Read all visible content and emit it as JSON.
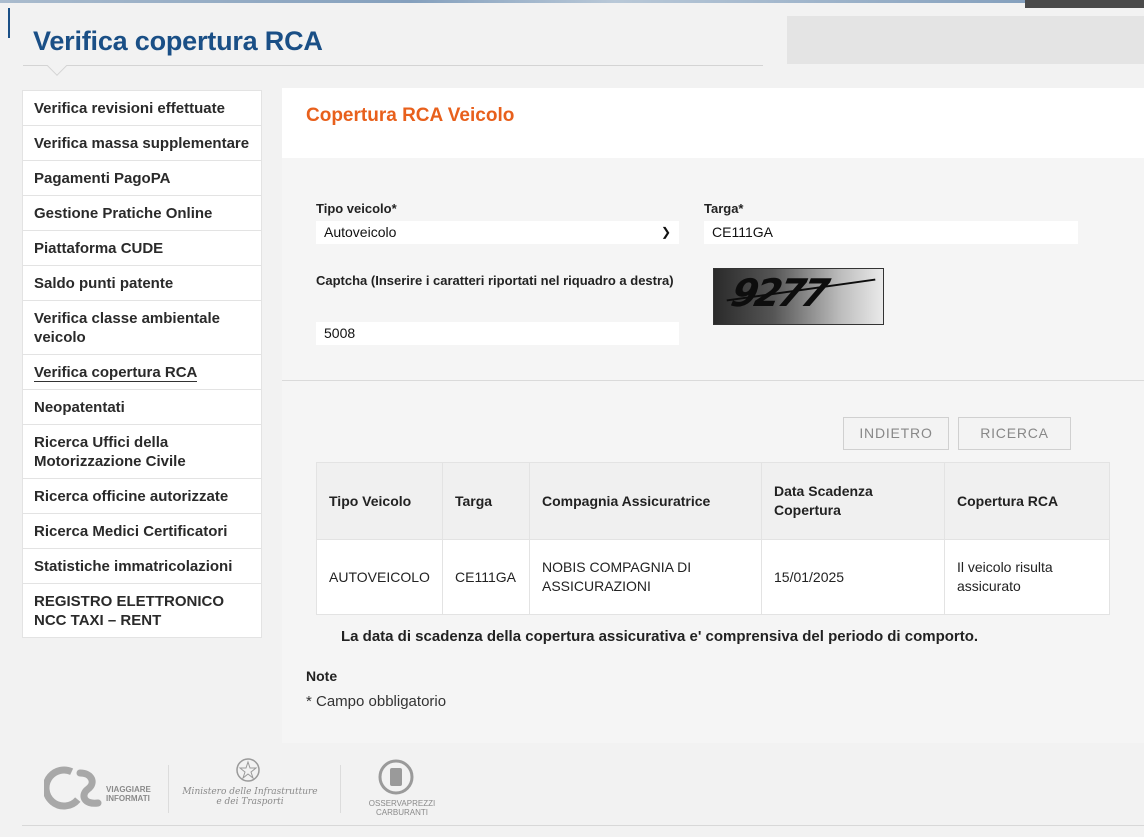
{
  "header": {
    "title": "Verifica copertura RCA"
  },
  "sidebar": {
    "items": [
      {
        "label": "Verifica revisioni effettuate"
      },
      {
        "label": "Verifica massa supplementare"
      },
      {
        "label": "Pagamenti PagoPA"
      },
      {
        "label": "Gestione Pratiche Online"
      },
      {
        "label": "Piattaforma CUDE"
      },
      {
        "label": "Saldo punti patente"
      },
      {
        "label": "Verifica classe ambientale veicolo"
      },
      {
        "label": "Verifica copertura RCA",
        "active": true
      },
      {
        "label": "Neopatentati"
      },
      {
        "label": "Ricerca Uffici della Motorizzazione Civile"
      },
      {
        "label": "Ricerca officine autorizzate"
      },
      {
        "label": "Ricerca Medici Certificatori"
      },
      {
        "label": "Statistiche immatricolazioni"
      },
      {
        "label": "REGISTRO ELETTRONICO NCC TAXI – RENT"
      }
    ]
  },
  "main": {
    "section_title": "Copertura RCA Veicolo",
    "form": {
      "tipo_label": "Tipo veicolo*",
      "tipo_value": "Autoveicolo",
      "targa_label": "Targa*",
      "targa_value": "CE111GA",
      "captcha_label": "Captcha (Inserire i caratteri riportati nel riquadro a destra)",
      "captcha_value": "5008",
      "captcha_image_text": "9277"
    },
    "buttons": {
      "back": "INDIETRO",
      "search": "RICERCA"
    },
    "table": {
      "headers": [
        "Tipo Veicolo",
        "Targa",
        "Compagnia Assicuratrice",
        "Data Scadenza Copertura",
        "Copertura RCA"
      ],
      "rows": [
        [
          "AUTOVEICOLO",
          "CE111GA",
          "NOBIS COMPAGNIA DI ASSICURAZIONI",
          "15/01/2025",
          "Il veicolo risulta assicurato"
        ]
      ]
    },
    "scadenza_note": "La data di scadenza della copertura assicurativa e' comprensiva del periodo di comporto.",
    "note_title": "Note",
    "note_text": "* Campo obbligatorio"
  },
  "footer": {
    "logo1_text": "VIAGGIARE INFORMATI",
    "logo2_text": "Ministero delle Infrastrutture e dei Trasporti",
    "logo3_line1": "OSSERVAPREZZI",
    "logo3_line2": "CARBURANTI"
  },
  "colors": {
    "title_blue": "#1a4f86",
    "accent_orange": "#e8601c"
  }
}
